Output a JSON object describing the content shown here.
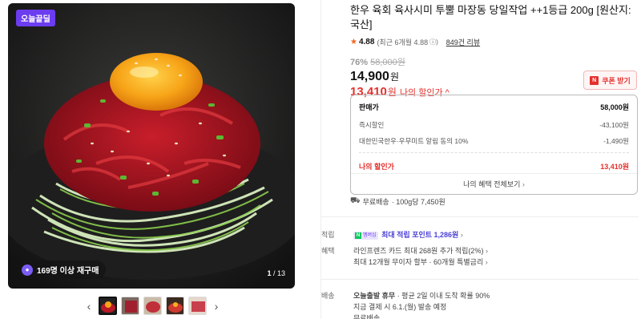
{
  "gallery": {
    "badge": "오늘끝딜",
    "rebuy": "169명 이상 재구매",
    "page_current": "1",
    "page_total": "/ 13",
    "prev_icon": "chevron-left",
    "next_icon": "chevron-right",
    "thumbnail_count": 5
  },
  "product": {
    "title": "한우 육회 육사시미 투뿔 마장동 당일작업 ++1등급 200g [원산지: 국산]",
    "rating": "4.88",
    "rating_detail": "(최근 6개월 4.88",
    "review_count": "849건 리뷰",
    "discount_pct": "76%",
    "original_price": "58,000원",
    "price": "14,900",
    "price_unit": "원",
    "my_price": "13,410",
    "my_price_unit": "원",
    "my_price_label": "나의 할인가 ^",
    "coupon_label": "쿠폰 받기"
  },
  "price_box": {
    "rows": [
      {
        "label": "판매가",
        "value": "58,000원"
      },
      {
        "label": "즉시할인",
        "value": "-43,100원"
      },
      {
        "label": "대한민국한우·우무미트 알림 동의 10%",
        "value": "-1,490원"
      }
    ],
    "mine_label": "나의 할인가",
    "mine_value": "13,410원",
    "benefit_link": "나의 혜택 전체보기"
  },
  "shipping": {
    "label": "무료배송",
    "detail": "· 100g당 7,450원"
  },
  "points": {
    "label": "적립",
    "badge_text": "멤버십",
    "text": "최대 적립 포인트 1,286원"
  },
  "benefits": {
    "label": "혜택",
    "line1": "라인프렌즈 카드 최대 268원 추가 적립(2%)",
    "line2": "최대 12개월 무이자 할부 · 60개월 특별금리"
  },
  "delivery": {
    "label": "배송",
    "line1_bold": "오늘출발 휴무",
    "line1_rest": " · 평균 2일 이내 도착 확률 90%",
    "line2": "지금 결제 시 6.1.(월) 발송 예정",
    "line3": "무료배송"
  },
  "colors": {
    "accent_red": "#e5302d",
    "accent_purple": "#6b3cf0",
    "naver_green": "#03c75a",
    "star_orange": "#f26522"
  }
}
